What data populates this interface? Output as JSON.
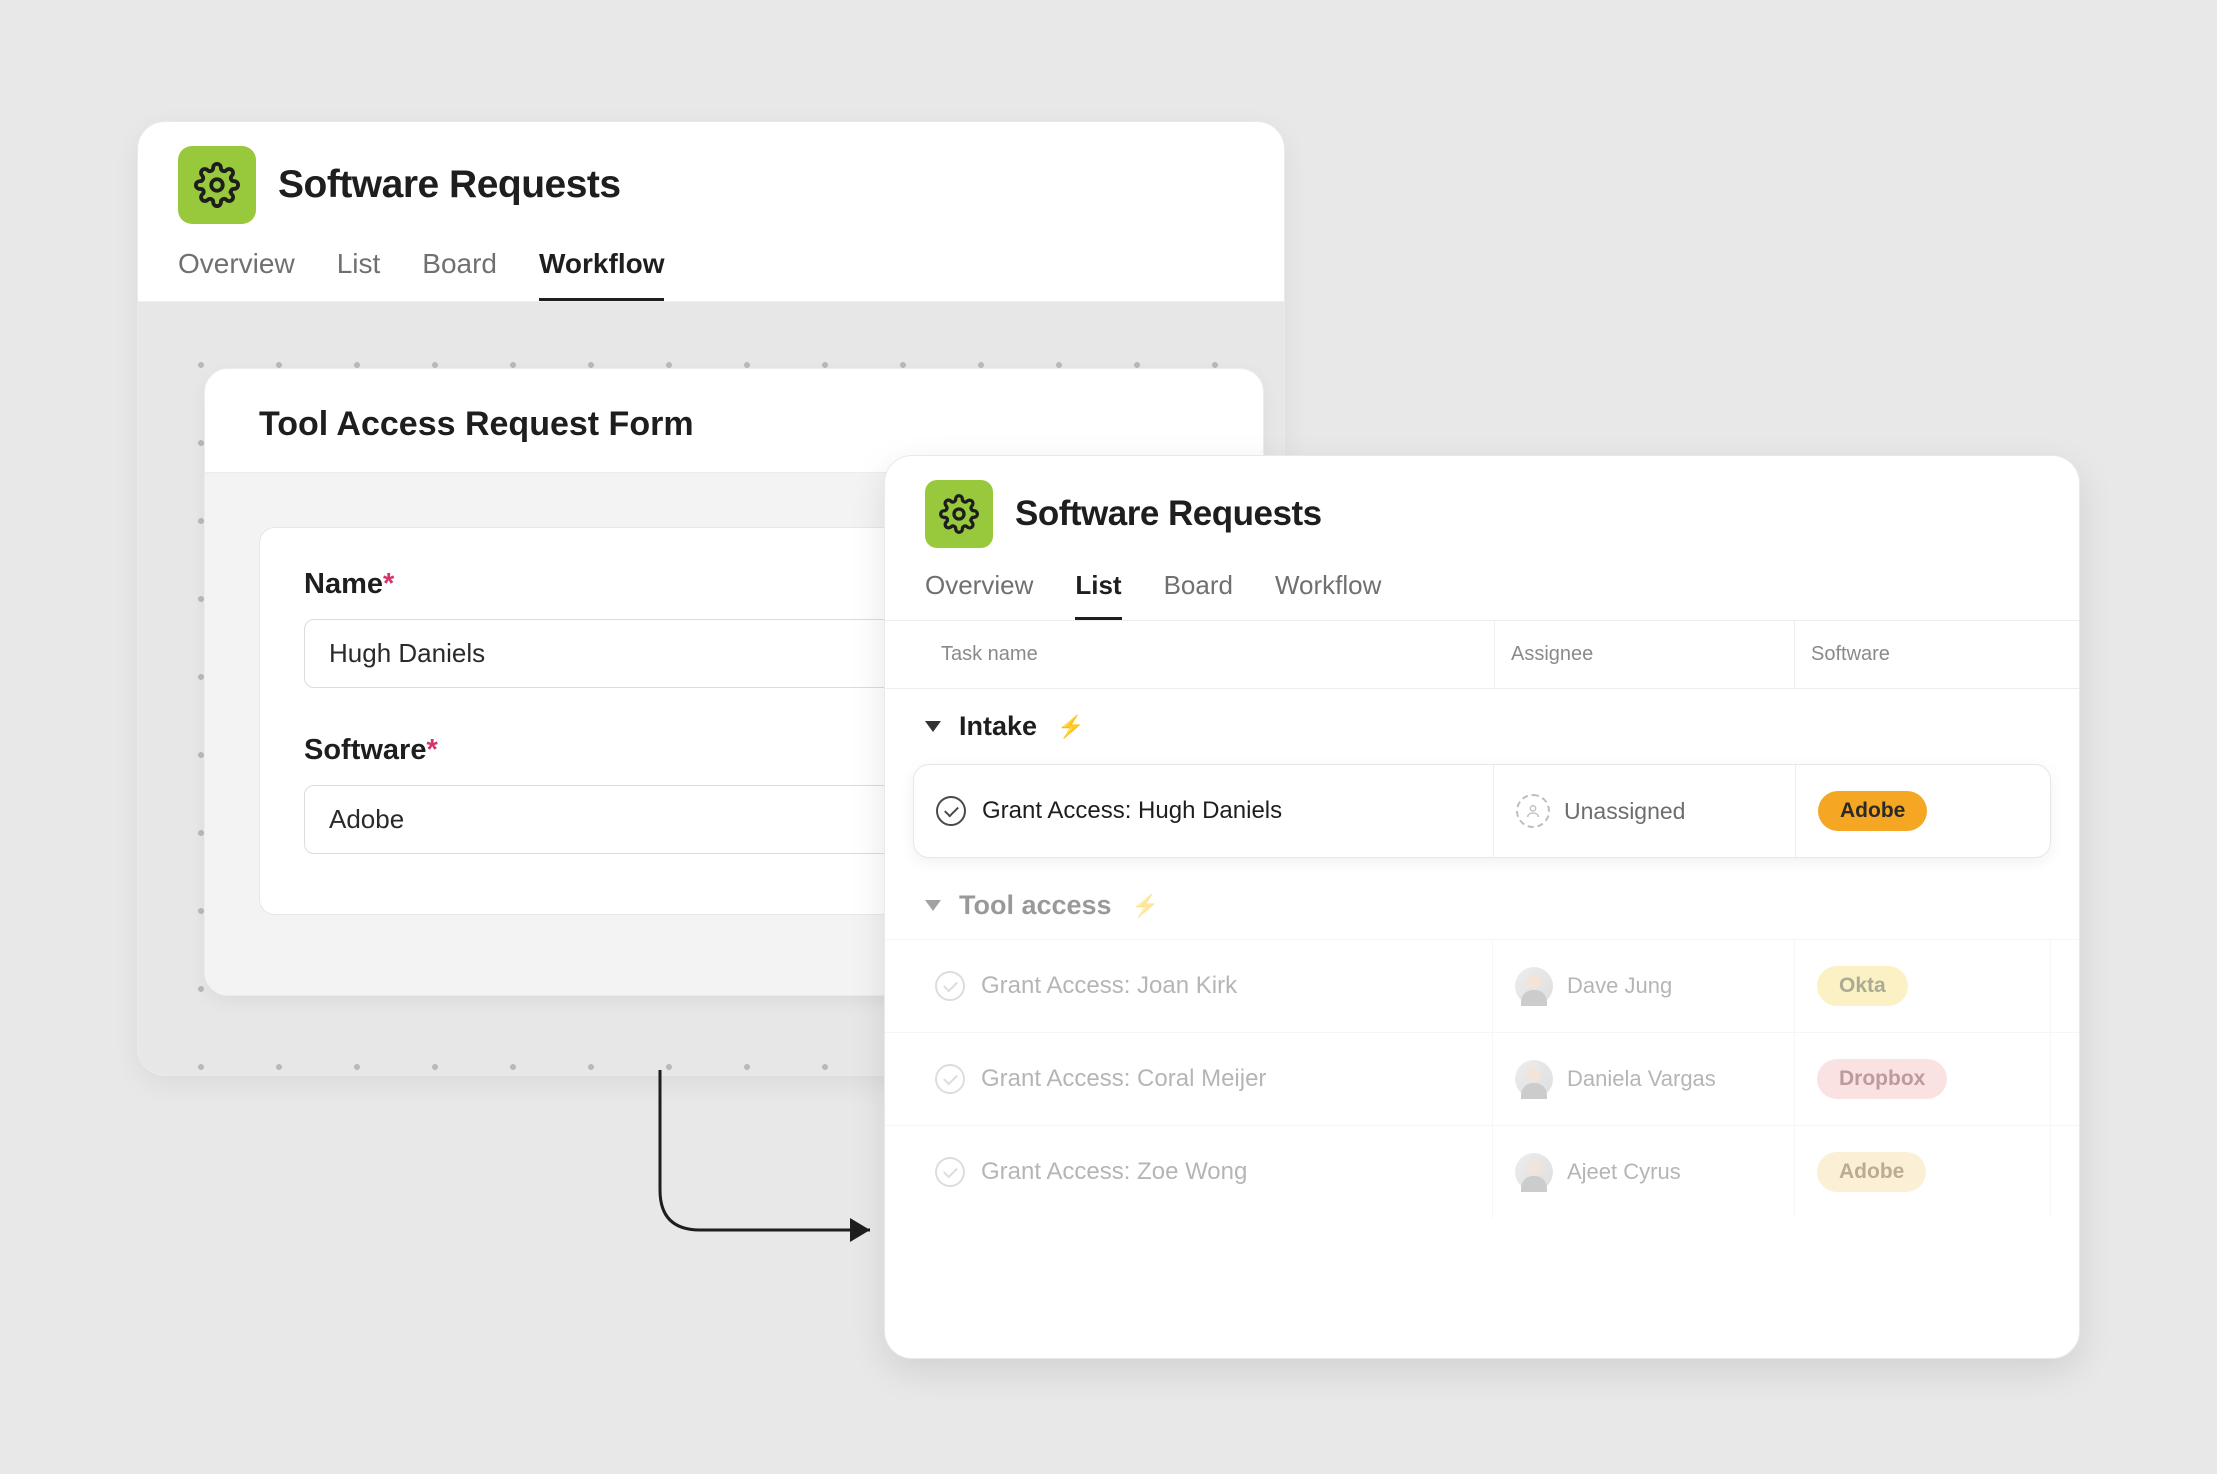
{
  "workflowCard": {
    "title": "Software Requests",
    "tabs": [
      "Overview",
      "List",
      "Board",
      "Workflow"
    ],
    "activeTab": "Workflow",
    "form": {
      "title": "Tool Access Request Form",
      "nameLabel": "Name",
      "nameValue": "Hugh Daniels",
      "softwareLabel": "Software",
      "softwareValue": "Adobe"
    }
  },
  "listCard": {
    "title": "Software Requests",
    "tabs": [
      "Overview",
      "List",
      "Board",
      "Workflow"
    ],
    "activeTab": "List",
    "columns": {
      "task": "Task name",
      "assignee": "Assignee",
      "software": "Software"
    },
    "sections": {
      "intake": {
        "title": "Intake",
        "rows": [
          {
            "task": "Grant Access: Hugh Daniels",
            "assignee": "Unassigned",
            "software": "Adobe",
            "softwareClass": "pill-adobe",
            "unassigned": true
          }
        ]
      },
      "toolAccess": {
        "title": "Tool access",
        "rows": [
          {
            "task": "Grant Access: Joan Kirk",
            "assignee": "Dave Jung",
            "software": "Okta",
            "softwareClass": "pill-okta"
          },
          {
            "task": "Grant Access: Coral Meijer",
            "assignee": "Daniela Vargas",
            "software": "Dropbox",
            "softwareClass": "pill-dropbox"
          },
          {
            "task": "Grant Access: Zoe Wong",
            "assignee": "Ajeet Cyrus",
            "software": "Adobe",
            "softwareClass": "pill-adobe2"
          }
        ]
      }
    }
  }
}
